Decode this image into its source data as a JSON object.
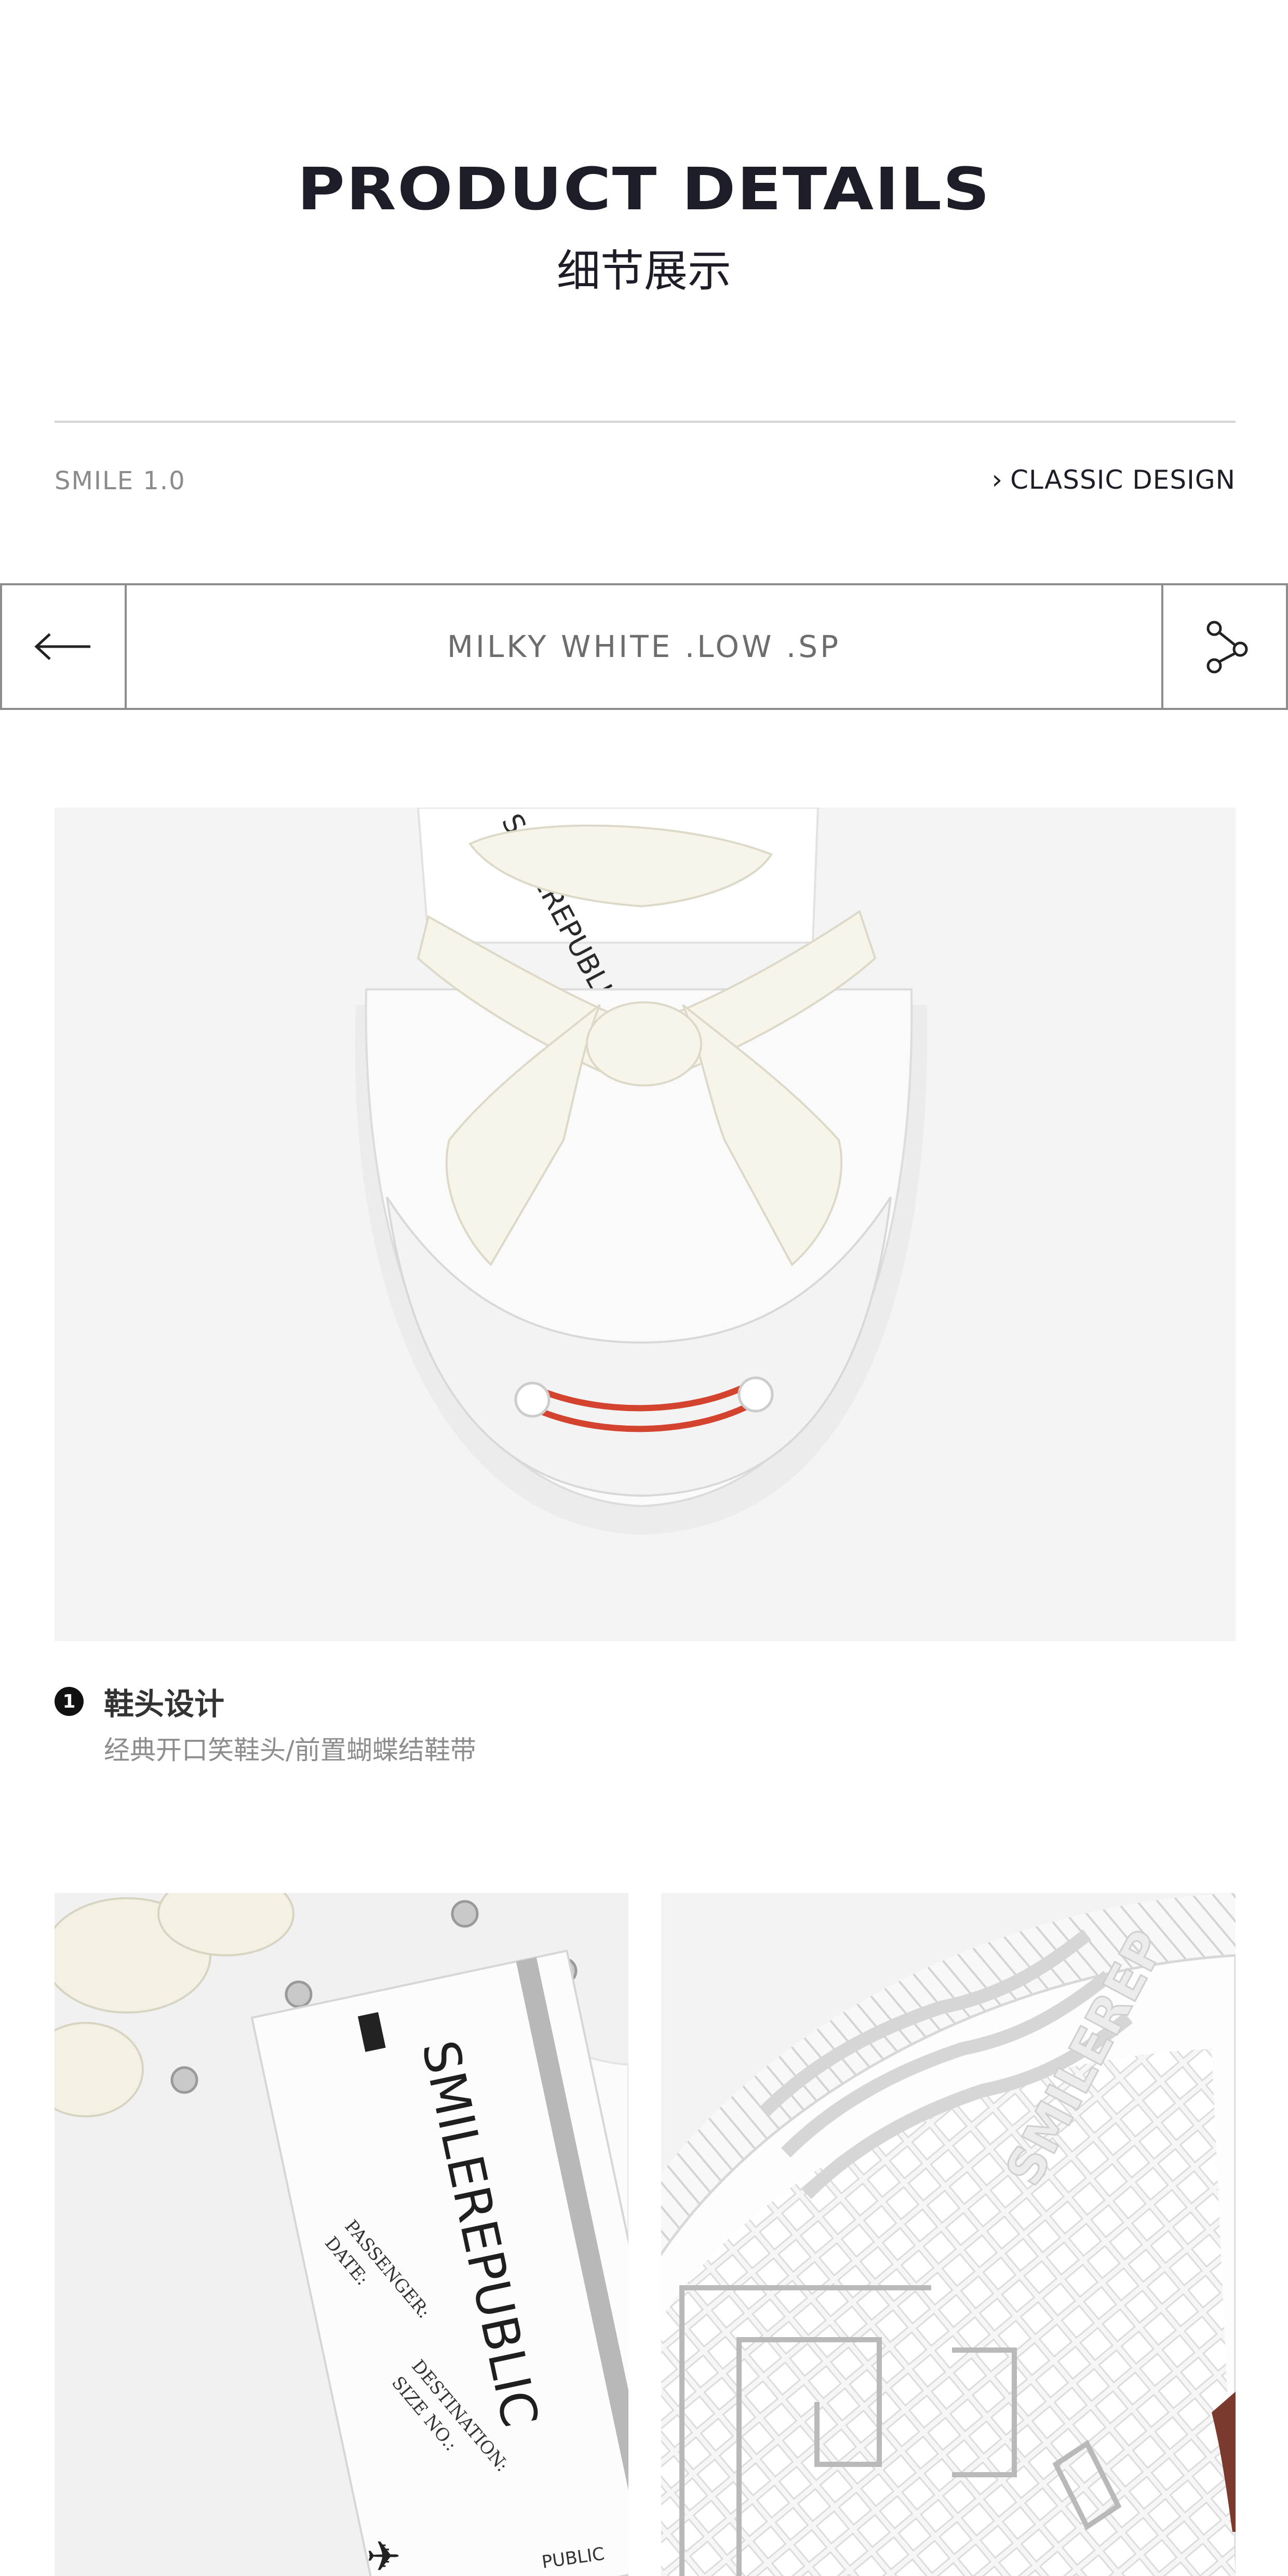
{
  "header": {
    "title_en": "PRODUCT DETAILS",
    "title_cn": "细节展示",
    "series": "SMILE 1.0",
    "design_link": "CLASSIC DESIGN"
  },
  "navbar": {
    "title": "MILKY WHITE .LOW .SP",
    "back_icon": "arrow-left-icon",
    "share_icon": "share-icon"
  },
  "hero_photo": {
    "tongue_label": "SMILEREPUBLIC"
  },
  "caption": {
    "number": "1",
    "title": "鞋头设计",
    "description": "经典开口笑鞋头/前置蝴蝶结鞋带"
  },
  "tag_photo": {
    "brand": "SMILEREPUBLIC",
    "passenger": "PASSENGER:",
    "date": "DATE:",
    "destination": "DESTINATION:",
    "size": "SIZE NO.:",
    "small": "PUBLIC"
  },
  "sole_photo": {
    "brand": "SMILEREP"
  },
  "colors": {
    "title": "#1d1d27",
    "border": "#8e8e8e",
    "smile_red": "#d4432e",
    "photo_bg": "#f4f4f4"
  }
}
